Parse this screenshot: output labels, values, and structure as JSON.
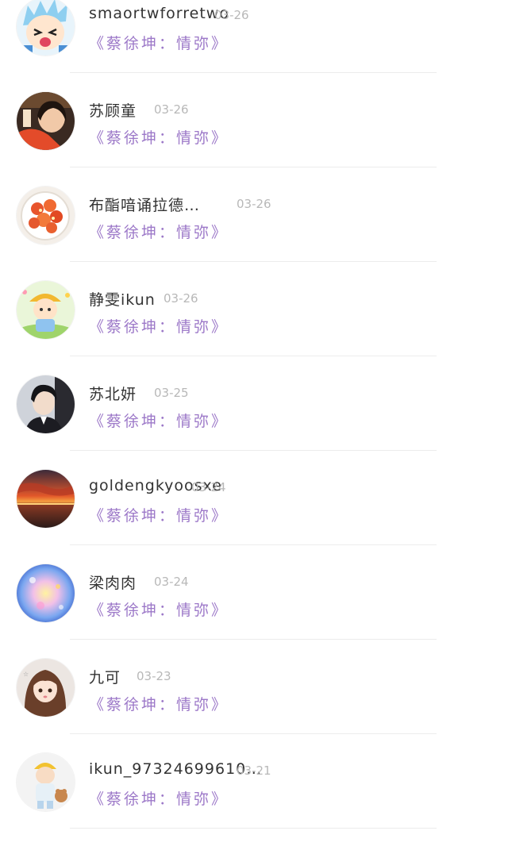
{
  "comments": [
    {
      "name": "smaortwforretwo",
      "date": "03-26",
      "track": "《蔡徐坤：情弥》",
      "avatar": "anime-boy-avatar"
    },
    {
      "name": "苏顾童",
      "date": "03-26",
      "track": "《蔡徐坤：情弥》",
      "avatar": "girl-photo-avatar"
    },
    {
      "name": "布酯喑诵拉德…",
      "date": "03-26",
      "track": "《蔡徐坤：情弥》",
      "avatar": "food-avatar"
    },
    {
      "name": "静雯ikun",
      "date": "03-26",
      "track": "《蔡徐坤：情弥》",
      "avatar": "cartoon-kid-avatar"
    },
    {
      "name": "苏北妍",
      "date": "03-25",
      "track": "《蔡徐坤：情弥》",
      "avatar": "boy-photo-avatar"
    },
    {
      "name": "goldengkyoosxe",
      "date": "03-24",
      "track": "《蔡徐坤：情弥》",
      "avatar": "sunset-avatar"
    },
    {
      "name": "梁肉肉",
      "date": "03-24",
      "track": "《蔡徐坤：情弥》",
      "avatar": "painting-avatar"
    },
    {
      "name": "九可",
      "date": "03-23",
      "track": "《蔡徐坤：情弥》",
      "avatar": "anime-girl-avatar"
    },
    {
      "name": "ikun_97324699610…",
      "date": "03-21",
      "track": "《蔡徐坤：情弥》",
      "avatar": "toddler-avatar"
    }
  ],
  "colors": {
    "track": "#9c78c8",
    "name": "#333333",
    "date": "#b8b8b8",
    "divider": "#ececec"
  }
}
